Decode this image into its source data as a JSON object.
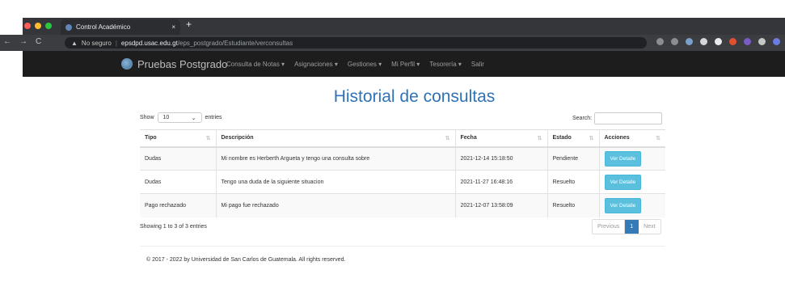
{
  "browser": {
    "tab_title": "Control Académico",
    "tab_close": "×",
    "new_tab": "+",
    "security_text": "No seguro",
    "url_host": "epsdpd.usac.edu.gt",
    "url_path": "/eps_postgrado/Estudiante/verconsultas",
    "nav_back": "←",
    "nav_forward": "→",
    "nav_reload": "C"
  },
  "navbar": {
    "brand": "Pruebas Postgrado",
    "menu": [
      "Consulta de Notas ▾",
      "Asignaciones ▾",
      "Gestiones ▾",
      "Mi Perfil ▾",
      "Tesorería ▾",
      "Salir"
    ]
  },
  "page": {
    "title": "Historial de consultas",
    "show_label": "Show",
    "entries_value": "10",
    "entries_label": "entries",
    "search_label": "Search:"
  },
  "table": {
    "headers": [
      "Tipo",
      "Descripción",
      "Fecha",
      "Estado",
      "Acciones"
    ],
    "rows": [
      {
        "tipo": "Dudas",
        "descripcion": "Mi nombre es Herberth Argueta y tengo una consulta sobre",
        "fecha": "2021-12-14 15:18:50",
        "estado": "Pendiente",
        "accion": "Ver Detalle"
      },
      {
        "tipo": "Dudas",
        "descripcion": "Tengo una duda de la siguiente situacion",
        "fecha": "2021-11-27 16:48:16",
        "estado": "Resuelto",
        "accion": "Ver Detalle"
      },
      {
        "tipo": "Pago rechazado",
        "descripcion": "Mi pago fue rechazado",
        "fecha": "2021-12-07 13:58:09",
        "estado": "Resuelto",
        "accion": "Ver Detalle"
      }
    ]
  },
  "pagination": {
    "info": "Showing 1 to 3 of 3 entries",
    "previous": "Previous",
    "current": "1",
    "next": "Next"
  },
  "footer": {
    "text": "© 2017 - 2022 by Universidad de San Carlos de Guatemala. All rights reserved."
  },
  "colors": {
    "title": "#2f72b5",
    "navbar_bg": "#1d1d1d",
    "button_info": "#5bc0de",
    "page_active": "#337ab7"
  }
}
